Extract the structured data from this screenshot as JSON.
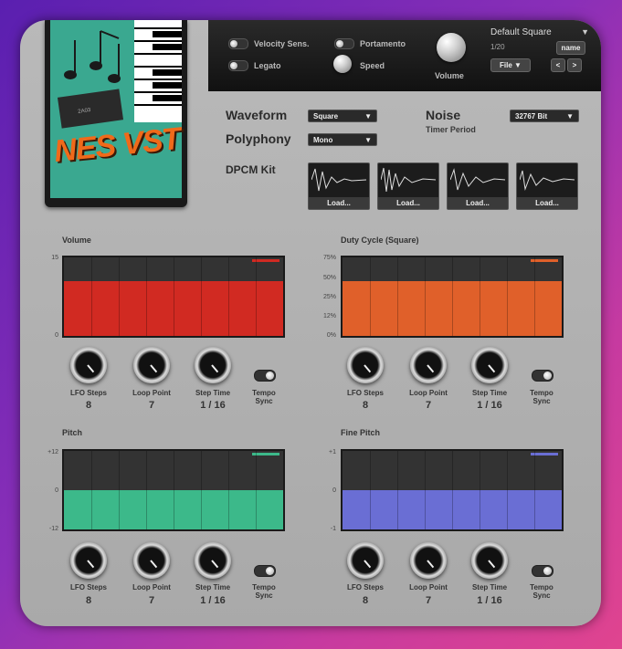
{
  "colors": {
    "volume": "#d12a22",
    "duty": "#e0602a",
    "pitch": "#3cb98a",
    "fine_pitch": "#6a6ed4"
  },
  "logo": {
    "title": "NES VST"
  },
  "topbar": {
    "velocity_sens": "Velocity Sens.",
    "legato": "Legato",
    "portamento": "Portamento",
    "speed": "Speed",
    "volume": "Volume",
    "preset_name": "Default Square",
    "preset_index": "1/20",
    "name_btn": "name",
    "file_btn": "File ▼",
    "prev_btn": "<",
    "next_btn": ">"
  },
  "controls": {
    "waveform_label": "Waveform",
    "waveform_value": "Square",
    "polyphony_label": "Polyphony",
    "polyphony_value": "Mono",
    "noise_label": "Noise",
    "timer_label": "Timer Period",
    "noise_value": "32767 Bit",
    "dpcm_label": "DPCM Kit",
    "load": "Load..."
  },
  "sections": {
    "volume": {
      "title": "Volume",
      "axis_top": "15",
      "axis_bottom": "0",
      "level": 0.7
    },
    "duty": {
      "title": "Duty Cycle (Square)",
      "axis": [
        "75%",
        "50%",
        "25%",
        "12%",
        "0%"
      ],
      "level": 0.7
    },
    "pitch": {
      "title": "Pitch",
      "axis_top": "+12",
      "axis_mid": "0",
      "axis_bottom": "-12",
      "level": 0.5
    },
    "fine_pitch": {
      "title": "Fine Pitch",
      "axis_top": "+1",
      "axis_mid": "0",
      "axis_bottom": "-1",
      "level": 0.5
    }
  },
  "lfo": {
    "steps_label": "LFO Steps",
    "steps_value": "8",
    "loop_label": "Loop Point",
    "loop_value": "7",
    "time_label": "Step Time",
    "time_value": "1 / 16",
    "tempo_label_1": "Tempo",
    "tempo_label_2": "Sync"
  }
}
